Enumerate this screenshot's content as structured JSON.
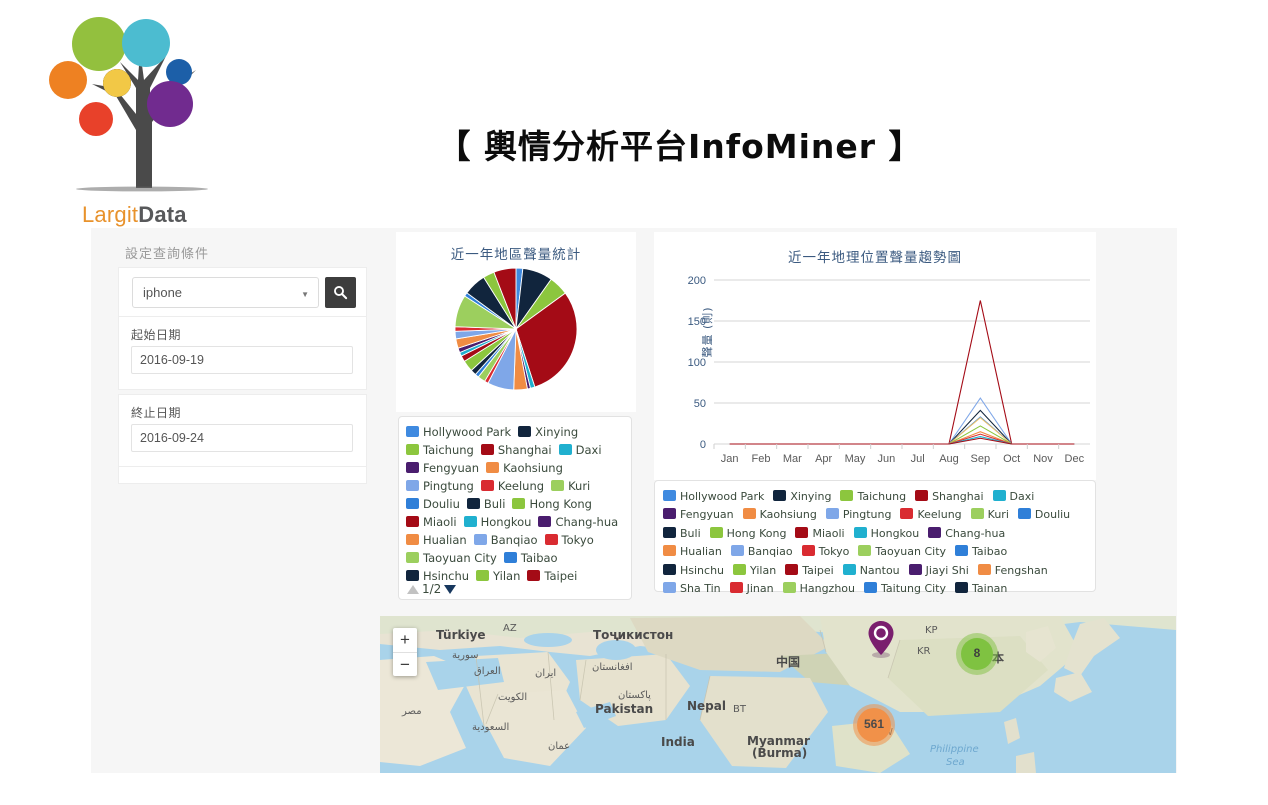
{
  "brand": {
    "name_part1": "Largit",
    "name_part2": "Data",
    "logo_alt": "largitdata-tree-logo"
  },
  "page": {
    "title": "【 輿情分析平台InfoMiner 】"
  },
  "query_panel": {
    "heading": "設定查詢條件",
    "keyword_value": "iphone",
    "keyword_caret": "▼",
    "search_icon": "search-icon",
    "start_label": "起始日期",
    "start_value": "2016-09-19",
    "end_label": "終止日期",
    "end_value": "2016-09-24"
  },
  "pie_panel": {
    "title": "近一年地區聲量統計",
    "pager": {
      "prev": "▲",
      "page": "1/2",
      "next": "▼"
    }
  },
  "line_panel": {
    "title": "近一年地理位置聲量趨勢圖",
    "ylabel": "聲量 (則)"
  },
  "map": {
    "zoom_in": "+",
    "zoom_out": "−",
    "clusters": [
      {
        "label": "561",
        "color": "#f19149"
      },
      {
        "label": "8",
        "color": "#7fc241"
      }
    ],
    "marker": "location-pin",
    "labels": [
      "Türkiye",
      "AZ",
      "Тоҷикистон",
      "سورية",
      "العراق",
      "ایران",
      "افغانستان",
      "الكويت",
      "مصر",
      "السعودية",
      "عمان",
      "پاکستان",
      "Pakistan",
      "Nepal",
      "BT",
      "India",
      "Myanmar",
      "(Burma)",
      "中国",
      "KP",
      "KR",
      "日本",
      "TW",
      "Philippine",
      "Sea"
    ]
  },
  "chart_data": [
    {
      "type": "pie",
      "title": "近一年地區聲量統計",
      "legend_position": "bottom",
      "categories": [
        "Hollywood Park",
        "Xinying",
        "Taichung",
        "Shanghai",
        "Daxi",
        "Fengyuan",
        "Kaohsiung",
        "Pingtung",
        "Keelung",
        "Kuri",
        "Douliu",
        "Buli",
        "Hong Kong",
        "Miaoli",
        "Hongkou",
        "Chang-hua",
        "Hualian",
        "Banqiao",
        "Tokyo",
        "Taoyuan City",
        "Taibao",
        "Hsinchu",
        "Yilan",
        "Taipei"
      ],
      "values": [
        1.8,
        8.0,
        5.2,
        30.0,
        1.2,
        0.8,
        3.6,
        7.0,
        1.0,
        2.0,
        1.0,
        1.5,
        3.0,
        1.6,
        1.0,
        1.2,
        2.5,
        2.0,
        1.2,
        8.5,
        1.0,
        6.0,
        3.0,
        5.9
      ],
      "colors": [
        "#3f8ae0",
        "#11253d",
        "#8cc63e",
        "#a40b16",
        "#20b0cf",
        "#4a1d6e",
        "#f08c44",
        "#7fa7e8",
        "#d92b31",
        "#9ccf5e",
        "#2f7fd8",
        "#11253d",
        "#8cc63e",
        "#a40b16",
        "#20b0cf",
        "#4a1d6e",
        "#f08c44",
        "#7fa7e8",
        "#d92b31",
        "#9ccf5e",
        "#2f7fd8",
        "#11253d",
        "#8cc63e",
        "#a40b16"
      ]
    },
    {
      "type": "line",
      "title": "近一年地理位置聲量趨勢圖",
      "xlabel": "",
      "ylabel": "聲量 (則)",
      "ylim": [
        0,
        200
      ],
      "yticks": [
        0,
        50,
        100,
        150,
        200
      ],
      "grid": true,
      "legend_position": "bottom",
      "x": [
        "Jan",
        "Feb",
        "Mar",
        "Apr",
        "May",
        "Jun",
        "Jul",
        "Aug",
        "Sep",
        "Oct",
        "Nov",
        "Dec"
      ],
      "series": [
        {
          "name": "Shanghai",
          "color": "#a40b16",
          "values": [
            0,
            0,
            0,
            0,
            0,
            0,
            0,
            0,
            175,
            0,
            0,
            0
          ]
        },
        {
          "name": "Pingtung",
          "color": "#7fa7e8",
          "values": [
            0,
            0,
            0,
            0,
            0,
            0,
            0,
            0,
            56,
            0,
            0,
            0
          ]
        },
        {
          "name": "Xinying",
          "color": "#11253d",
          "values": [
            0,
            0,
            0,
            0,
            0,
            0,
            0,
            0,
            41,
            0,
            0,
            0
          ]
        },
        {
          "name": "Hollywood Park",
          "color": "#3f8ae0",
          "values": [
            0,
            0,
            0,
            0,
            0,
            0,
            0,
            0,
            33,
            0,
            0,
            0
          ]
        },
        {
          "name": "Kaohsiung",
          "color": "#f0c36a",
          "values": [
            0,
            0,
            0,
            0,
            0,
            0,
            0,
            0,
            32,
            0,
            0,
            0
          ]
        },
        {
          "name": "Taichung",
          "color": "#8cc63e",
          "values": [
            0,
            0,
            0,
            0,
            0,
            0,
            0,
            0,
            22,
            0,
            0,
            0
          ]
        },
        {
          "name": "Hualian",
          "color": "#f08c44",
          "values": [
            0,
            0,
            0,
            0,
            0,
            0,
            0,
            0,
            15,
            0,
            0,
            0
          ]
        },
        {
          "name": "Keelung",
          "color": "#d92b31",
          "values": [
            0,
            0,
            0,
            0,
            0,
            0,
            0,
            0,
            12,
            0,
            0,
            0
          ]
        },
        {
          "name": "Daxi",
          "color": "#20b0cf",
          "values": [
            0,
            0,
            0,
            0,
            0,
            0,
            0,
            0,
            9,
            0,
            0,
            0
          ]
        },
        {
          "name": "Taipei",
          "color": "#a40b16",
          "values": [
            0,
            0,
            0,
            0,
            0,
            0,
            0,
            0,
            7,
            0,
            0,
            0
          ]
        }
      ],
      "legend": [
        {
          "label": "Hollywood Park",
          "color": "#3f8ae0"
        },
        {
          "label": "Xinying",
          "color": "#11253d"
        },
        {
          "label": "Taichung",
          "color": "#8cc63e"
        },
        {
          "label": "Shanghai",
          "color": "#a40b16"
        },
        {
          "label": "Daxi",
          "color": "#20b0cf"
        },
        {
          "label": "Fengyuan",
          "color": "#4a1d6e"
        },
        {
          "label": "Kaohsiung",
          "color": "#f08c44"
        },
        {
          "label": "Pingtung",
          "color": "#7fa7e8"
        },
        {
          "label": "Keelung",
          "color": "#d92b31"
        },
        {
          "label": "Kuri",
          "color": "#9ccf5e"
        },
        {
          "label": "Douliu",
          "color": "#2f7fd8"
        },
        {
          "label": "Buli",
          "color": "#11253d"
        },
        {
          "label": "Hong Kong",
          "color": "#8cc63e"
        },
        {
          "label": "Miaoli",
          "color": "#a40b16"
        },
        {
          "label": "Hongkou",
          "color": "#20b0cf"
        },
        {
          "label": "Chang-hua",
          "color": "#4a1d6e"
        },
        {
          "label": "Hualian",
          "color": "#f08c44"
        },
        {
          "label": "Banqiao",
          "color": "#7fa7e8"
        },
        {
          "label": "Tokyo",
          "color": "#d92b31"
        },
        {
          "label": "Taoyuan City",
          "color": "#9ccf5e"
        },
        {
          "label": "Taibao",
          "color": "#2f7fd8"
        },
        {
          "label": "Hsinchu",
          "color": "#11253d"
        },
        {
          "label": "Yilan",
          "color": "#8cc63e"
        },
        {
          "label": "Taipei",
          "color": "#a40b16"
        },
        {
          "label": "Nantou",
          "color": "#20b0cf"
        },
        {
          "label": "Jiayi Shi",
          "color": "#4a1d6e"
        },
        {
          "label": "Fengshan",
          "color": "#f08c44"
        },
        {
          "label": "Sha Tin",
          "color": "#7fa7e8"
        },
        {
          "label": "Jinan",
          "color": "#d92b31"
        },
        {
          "label": "Hangzhou",
          "color": "#9ccf5e"
        },
        {
          "label": "Taitung City",
          "color": "#2f7fd8"
        },
        {
          "label": "Tainan",
          "color": "#11253d"
        }
      ]
    }
  ]
}
